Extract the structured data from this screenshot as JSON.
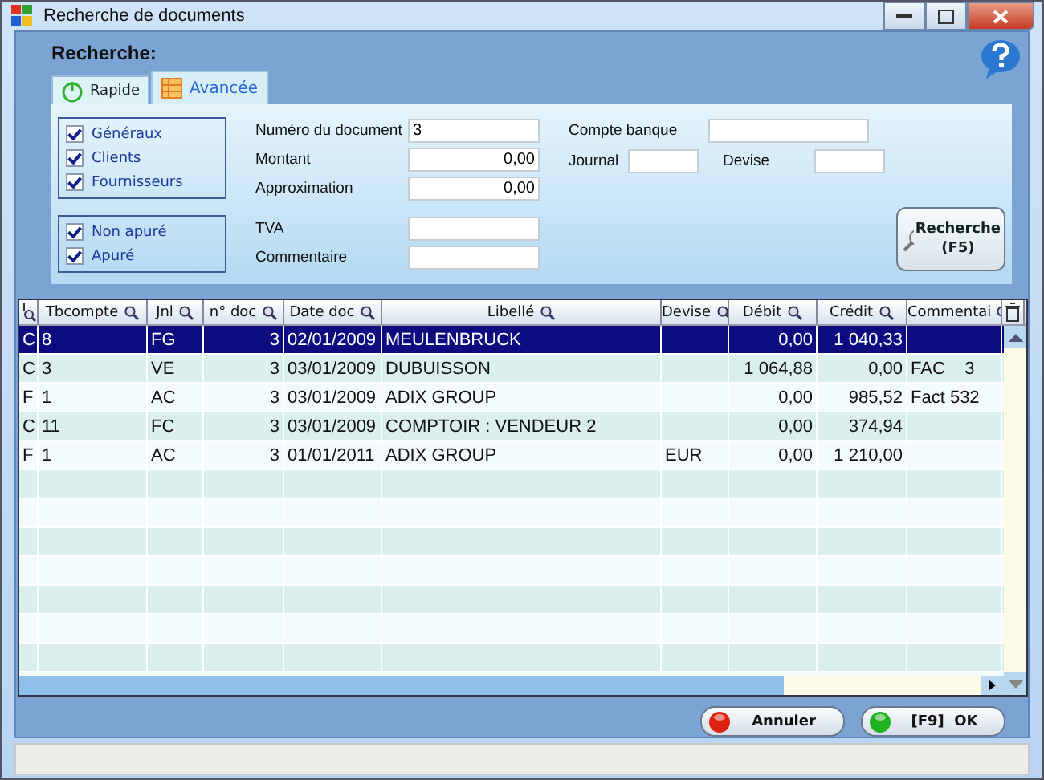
{
  "window": {
    "title": "Recherche de documents"
  },
  "search": {
    "heading": "Recherche:",
    "tabs": [
      {
        "label": "Rapide",
        "selected": true
      },
      {
        "label": "Avancée",
        "selected": false
      }
    ],
    "account_types": [
      {
        "label": "Généraux",
        "checked": true
      },
      {
        "label": "Clients",
        "checked": true
      },
      {
        "label": "Fournisseurs",
        "checked": true
      }
    ],
    "status_filters": [
      {
        "label": "Non apuré",
        "checked": true
      },
      {
        "label": "Apuré",
        "checked": true
      }
    ],
    "fields": {
      "numero": {
        "label": "Numéro du document",
        "value": "3"
      },
      "montant": {
        "label": "Montant",
        "value": "0,00"
      },
      "approximation": {
        "label": "Approximation",
        "value": "0,00"
      },
      "tva": {
        "label": "TVA"
      },
      "commentaire": {
        "label": "Commentaire"
      },
      "compte_banque": {
        "label": "Compte banque"
      },
      "journal": {
        "label": "Journal"
      },
      "devise": {
        "label": "Devise"
      }
    },
    "search_button": {
      "label": "Recherche",
      "shortcut": "(F5)"
    }
  },
  "table": {
    "columns": [
      "Tbcompte",
      "Jnl",
      "n° doc",
      "Date doc",
      "Libellé",
      "Devise",
      "Débit",
      "Crédit",
      "Commentai"
    ],
    "rows": [
      {
        "type": "C",
        "compte": "8",
        "jnl": "FG",
        "ndoc": "3",
        "date": "02/01/2009",
        "libelle": "MEULENBRUCK",
        "devise": "",
        "debit": "0,00",
        "credit": "1 040,33",
        "commentaire": "",
        "selected": true
      },
      {
        "type": "C",
        "compte": "3",
        "jnl": "VE",
        "ndoc": "3",
        "date": "03/01/2009",
        "libelle": "DUBUISSON",
        "devise": "",
        "debit": "1 064,88",
        "credit": "0,00",
        "commentaire": "FAC    3",
        "selected": false
      },
      {
        "type": "F",
        "compte": "1",
        "jnl": "AC",
        "ndoc": "3",
        "date": "03/01/2009",
        "libelle": "ADIX GROUP",
        "devise": "",
        "debit": "0,00",
        "credit": "985,52",
        "commentaire": "Fact 532",
        "selected": false
      },
      {
        "type": "C",
        "compte": "11",
        "jnl": "FC",
        "ndoc": "3",
        "date": "03/01/2009",
        "libelle": "COMPTOIR : VENDEUR 2",
        "devise": "",
        "debit": "0,00",
        "credit": "374,94",
        "commentaire": "",
        "selected": false
      },
      {
        "type": "F",
        "compte": "1",
        "jnl": "AC",
        "ndoc": "3",
        "date": "01/01/2011",
        "libelle": "ADIX GROUP",
        "devise": "EUR",
        "debit": "0,00",
        "credit": "1 210,00",
        "commentaire": "",
        "selected": false
      }
    ]
  },
  "buttons": [
    {
      "kind": "cancel",
      "label": "Annuler"
    },
    {
      "kind": "ok",
      "label": "[F9]  OK"
    }
  ]
}
